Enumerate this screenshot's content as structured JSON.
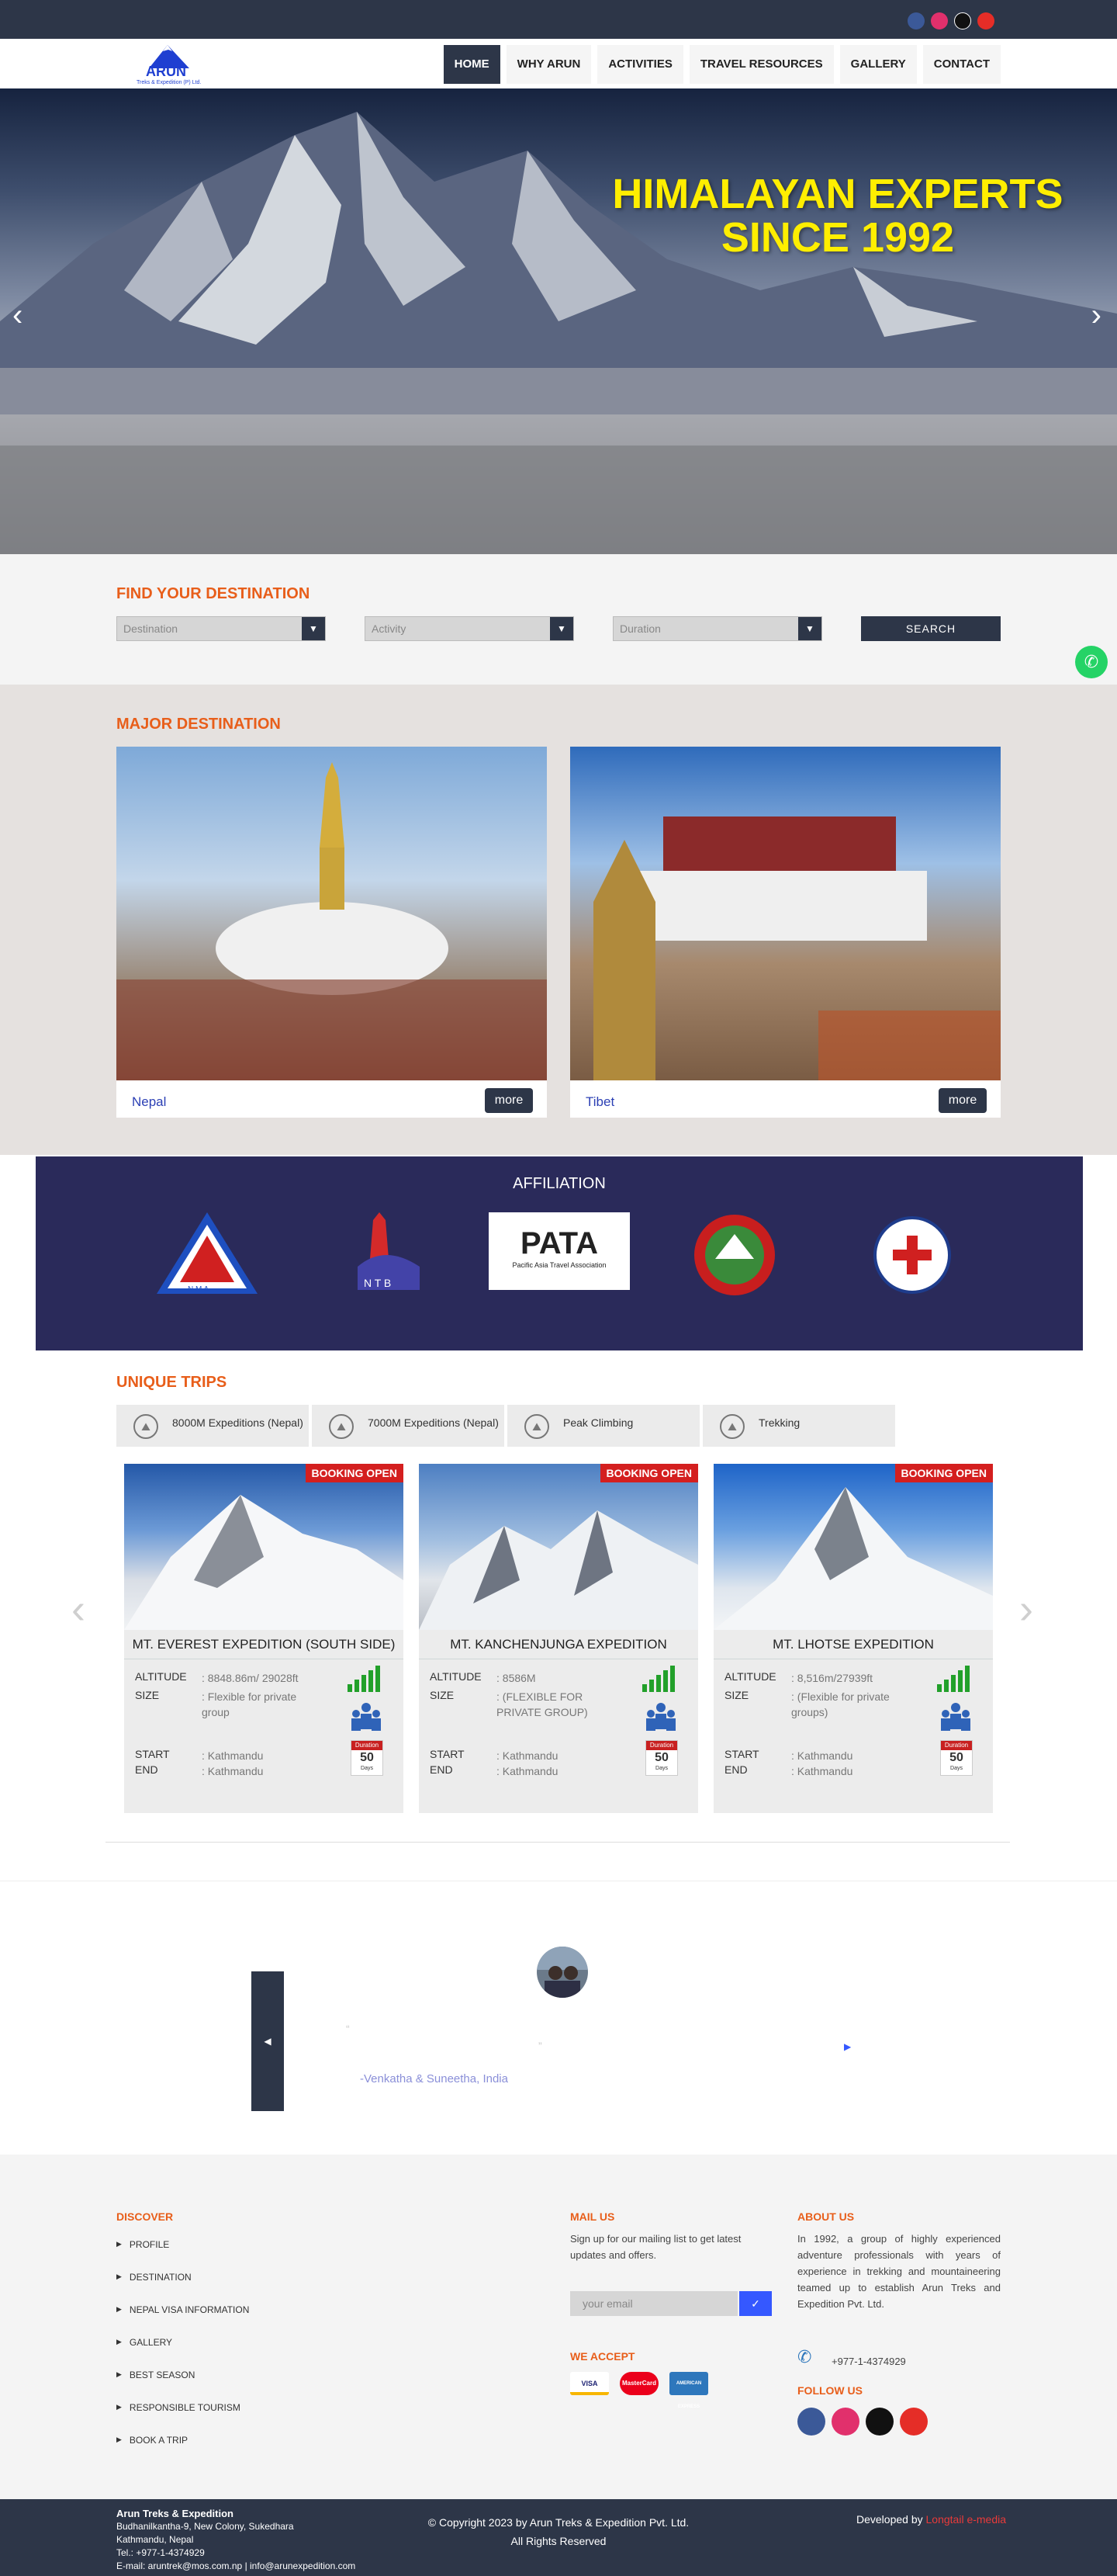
{
  "header": {
    "logo_text": "ARUN",
    "logo_sub": "Treks & Expedition (P) Ltd.",
    "socials": [
      "facebook-icon",
      "instagram-icon",
      "tiktok-icon",
      "youtube-icon"
    ],
    "menu": [
      {
        "label": "HOME",
        "active": true
      },
      {
        "label": "WHY ARUN"
      },
      {
        "label": "ACTIVITIES"
      },
      {
        "label": "TRAVEL RESOURCES"
      },
      {
        "label": "GALLERY"
      },
      {
        "label": "CONTACT"
      }
    ]
  },
  "hero": {
    "line1": "HIMALAYAN EXPERTS",
    "line2": "SINCE 1992",
    "prev": "‹",
    "next": "›"
  },
  "search": {
    "title": "FIND YOUR DESTINATION",
    "destination_placeholder": "Destination",
    "activity_placeholder": "Activity",
    "duration_placeholder": "Duration",
    "button": "SEARCH"
  },
  "major": {
    "title": "MAJOR DESTINATION",
    "items": [
      {
        "name": "Nepal",
        "more": "more"
      },
      {
        "name": "Tibet",
        "more": "more"
      }
    ]
  },
  "affiliation": {
    "title": "AFFILIATION",
    "nma": "N M A",
    "ntb": "N T B",
    "pata": "PATA",
    "pata_sub": "Pacific Asia Travel Association"
  },
  "unique": {
    "title": "UNIQUE TRIPS",
    "tabs": [
      "8000M Expeditions (Nepal)",
      "7000M Expeditions (Nepal)",
      "Peak Climbing",
      "Trekking"
    ],
    "cards": [
      {
        "badge": "BOOKING OPEN",
        "title": "MT. EVEREST EXPEDITION (SOUTH SIDE)",
        "altitude": ": 8848.86m/ 29028ft",
        "size": ": Flexible for private group",
        "start": ": Kathmandu",
        "end": ": Kathmandu",
        "duration": "50"
      },
      {
        "badge": "BOOKING OPEN",
        "title": "MT. KANCHENJUNGA EXPEDITION",
        "altitude": ": 8586M",
        "size": ": (FLEXIBLE FOR PRIVATE GROUP)",
        "start": ": Kathmandu",
        "end": ": Kathmandu",
        "duration": "50"
      },
      {
        "badge": "BOOKING OPEN",
        "title": "MT. LHOTSE EXPEDITION",
        "altitude": ": 8,516m/27939ft",
        "size": ": (Flexible for private groups)",
        "start": ": Kathmandu",
        "end": ": Kathmandu",
        "duration": "50"
      }
    ],
    "labels": {
      "altitude": "ALTITUDE",
      "size": "SIZE",
      "start": "START",
      "end": "END",
      "duration_head": "Duration",
      "days": "Days"
    }
  },
  "testimonial": {
    "author": "-Venkatha & Suneetha, India",
    "open_quote": "“",
    "close_quote": "”",
    "prev": "◀",
    "next": "▶"
  },
  "footer": {
    "discover_title": "DISCOVER",
    "discover_links": [
      "PROFILE",
      "DESTINATION",
      "NEPAL VISA INFORMATION",
      "GALLERY",
      "BEST SEASON",
      "RESPONSIBLE TOURISM",
      "BOOK A TRIP"
    ],
    "mail_title": "MAIL US",
    "mail_text": "Sign up for our mailing list to get latest updates and offers.",
    "email_placeholder": "your email",
    "email_btn": "✓",
    "accept_title": "WE ACCEPT",
    "accept": [
      "VISA",
      "MasterCard",
      "AMERICAN EXPRESS"
    ],
    "about_title": "ABOUT US",
    "about_text": "In 1992, a group of highly experienced adventure professionals with years of experience in trekking and mountaineering teamed up to establish Arun Treks and Expedition Pvt. Ltd.",
    "phone": "+977-1-4374929",
    "follow_title": "FOLLOW US"
  },
  "bottom": {
    "company": "Arun Treks & Expedition",
    "addr1": "Budhanilkantha-9, New Colony, Sukedhara",
    "addr2": "Kathmandu, Nepal",
    "tel": "Tel.: +977-1-4374929",
    "email": "E-mail: aruntrek@mos.com.np | info@arunexpedition.com",
    "copyright": "© Copyright 2023 by Arun Treks & Expedition Pvt. Ltd.",
    "rights": "All Rights Reserved",
    "dev_label": "Developed by",
    "dev_name": "Longtail e-media"
  },
  "colors": {
    "accent": "#e85e1a",
    "dark": "#2d3648",
    "brand_blue": "#2b3fb4",
    "badge_red": "#d41f1f"
  }
}
